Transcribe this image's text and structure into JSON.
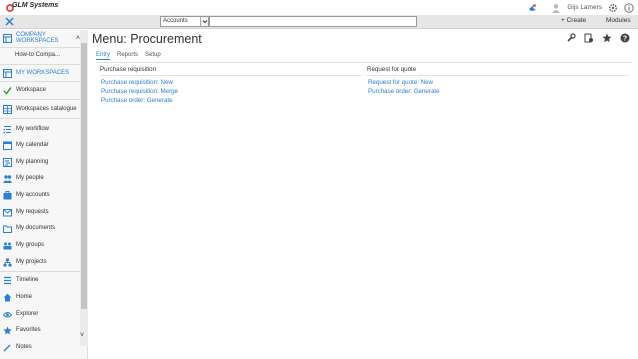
{
  "logo": {
    "text": "GLM Systems"
  },
  "user": {
    "name": "Gijs Lamers"
  },
  "search": {
    "scope": "Accounts",
    "placeholder": ""
  },
  "toolbar": {
    "create_label": "+ Create",
    "modules_label": "Modules"
  },
  "sidebar": {
    "items": [
      {
        "label": "COMPANY WORKSPACES",
        "icon": "workspace-grid-icon",
        "header": true
      },
      {
        "label": "How-to Compa...",
        "icon": "",
        "header": false
      },
      {
        "label": "MY WORKSPACES",
        "icon": "workspace-grid-icon",
        "header": true
      },
      {
        "label": "Workspace",
        "icon": "check-icon",
        "header": false
      },
      {
        "label": "Workspaces catalogue",
        "icon": "catalogue-icon",
        "header": false
      },
      {
        "label": "My workflow",
        "icon": "workflow-icon",
        "header": false
      },
      {
        "label": "My calendar",
        "icon": "calendar-icon",
        "header": false
      },
      {
        "label": "My planning",
        "icon": "planning-icon",
        "header": false
      },
      {
        "label": "My people",
        "icon": "people-icon",
        "header": false
      },
      {
        "label": "My accounts",
        "icon": "accounts-icon",
        "header": false
      },
      {
        "label": "My requests",
        "icon": "requests-icon",
        "header": false
      },
      {
        "label": "My documents",
        "icon": "documents-icon",
        "header": false
      },
      {
        "label": "My groups",
        "icon": "groups-icon",
        "header": false
      },
      {
        "label": "My projects",
        "icon": "projects-icon",
        "header": false
      },
      {
        "label": "Timeline",
        "icon": "timeline-icon",
        "header": false
      },
      {
        "label": "Home",
        "icon": "home-icon",
        "header": false
      },
      {
        "label": "Explorer",
        "icon": "explorer-icon",
        "header": false
      },
      {
        "label": "Favorites",
        "icon": "star-icon",
        "header": false
      },
      {
        "label": "Notes",
        "icon": "notes-icon",
        "header": false
      }
    ]
  },
  "main": {
    "title": "Menu: Procurement",
    "tabs": [
      {
        "label": "Entry",
        "active": true
      },
      {
        "label": "Reports",
        "active": false
      },
      {
        "label": "Setup",
        "active": false
      }
    ],
    "columns": [
      {
        "heading": "Purchase requisition",
        "links": [
          "Purchase requisition: New",
          "Purchase requisition: Merge",
          "Purchase order: Generate"
        ]
      },
      {
        "heading": "Request for quote",
        "links": [
          "Request for quote: New",
          "Purchase order: Generate"
        ]
      }
    ]
  },
  "colors": {
    "accent": "#2d7ed8",
    "bar": "#e6e6e6"
  }
}
